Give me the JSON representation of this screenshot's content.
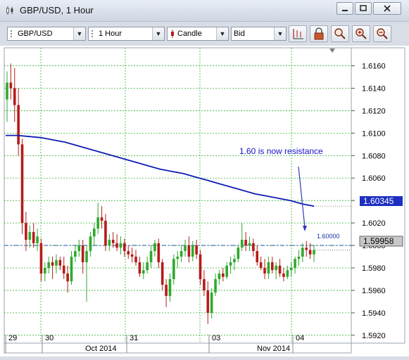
{
  "window": {
    "title": "GBP/USD,  1 Hour"
  },
  "toolbar": {
    "symbol": "GBP/USD",
    "timeframe": "1 Hour",
    "chart_type": "Candle",
    "price_side": "Bid",
    "buttons": [
      "grid-icon",
      "lock-icon",
      "zoom-icon",
      "zoom-in-icon",
      "zoom-out-icon"
    ]
  },
  "chart_data": {
    "type": "candlestick",
    "y_ticks": [
      "1.6160",
      "1.6140",
      "1.6120",
      "1.6100",
      "1.6080",
      "1.6060",
      "1.6040",
      "1.6020",
      "1.6000",
      "1.5980",
      "1.5960",
      "1.5940",
      "1.5920"
    ],
    "ylim": [
      1.5913,
      1.6176
    ],
    "x_day_labels": [
      "29",
      "30",
      "31",
      "03",
      "04"
    ],
    "x_month_labels": [
      "Oct 2014",
      "Nov 2014"
    ],
    "annotation": "1.60 is now resistance",
    "line_label": "1.60000",
    "price_badges": {
      "ma": "1.60345",
      "current": "1.59958"
    },
    "colors": {
      "up": "#2ea92e",
      "down": "#b51b1b",
      "ma": "#0d1cb5",
      "grid": "#35b535",
      "level": "#1133aa"
    },
    "candles": [
      [
        1.613,
        1.6155,
        1.611,
        1.6145
      ],
      [
        1.6145,
        1.6162,
        1.613,
        1.614
      ],
      [
        1.614,
        1.6158,
        1.611,
        1.6125
      ],
      [
        1.6125,
        1.614,
        1.608,
        1.609
      ],
      [
        1.609,
        1.6095,
        1.601,
        1.602
      ],
      [
        1.602,
        1.603,
        1.5995,
        1.6005
      ],
      [
        1.6005,
        1.6018,
        1.5998,
        1.6012
      ],
      [
        1.6012,
        1.602,
        1.5998,
        1.6002
      ],
      [
        1.6002,
        1.6015,
        1.5995,
        1.6008
      ],
      [
        1.6002,
        1.6006,
        1.5968,
        1.5975
      ],
      [
        1.5975,
        1.5985,
        1.5968,
        1.598
      ],
      [
        1.598,
        1.599,
        1.5975,
        1.5985
      ],
      [
        1.5985,
        1.599,
        1.597,
        1.5982
      ],
      [
        1.5982,
        1.5992,
        1.5975,
        1.5987
      ],
      [
        1.5987,
        1.599,
        1.5978,
        1.5982
      ],
      [
        1.5982,
        1.599,
        1.597,
        1.5975
      ],
      [
        1.5975,
        1.5982,
        1.5958,
        1.5968
      ],
      [
        1.5968,
        1.5995,
        1.5965,
        1.599
      ],
      [
        1.599,
        1.6,
        1.5985,
        1.5995
      ],
      [
        1.5995,
        1.6005,
        1.599,
        1.6
      ],
      [
        1.6,
        1.6005,
        1.5975,
        1.5985
      ],
      [
        1.5985,
        1.6,
        1.595,
        1.5995
      ],
      [
        1.5995,
        1.6012,
        1.599,
        1.6008
      ],
      [
        1.6008,
        1.602,
        1.6,
        1.6015
      ],
      [
        1.6015,
        1.6038,
        1.601,
        1.6025
      ],
      [
        1.6025,
        1.6035,
        1.6015,
        1.6022
      ],
      [
        1.6022,
        1.6028,
        1.5995,
        1.6
      ],
      [
        1.6,
        1.601,
        1.5995,
        1.6005
      ],
      [
        1.6005,
        1.6012,
        1.5998,
        1.6002
      ],
      [
        1.6002,
        1.601,
        1.5995,
        1.5998
      ],
      [
        1.5998,
        1.6008,
        1.5992,
        1.6002
      ],
      [
        1.6002,
        1.6006,
        1.599,
        1.5995
      ],
      [
        1.5995,
        1.6,
        1.5988,
        1.5992
      ],
      [
        1.5992,
        1.5998,
        1.5985,
        1.599
      ],
      [
        1.599,
        1.5996,
        1.5982,
        1.5985
      ],
      [
        1.5985,
        1.599,
        1.5972,
        1.5975
      ],
      [
        1.5975,
        1.5985,
        1.597,
        1.5978
      ],
      [
        1.5978,
        1.599,
        1.5975,
        1.5985
      ],
      [
        1.5985,
        1.6,
        1.598,
        1.5995
      ],
      [
        1.5995,
        1.6005,
        1.599,
        1.6002
      ],
      [
        1.6002,
        1.6006,
        1.598,
        1.5985
      ],
      [
        1.5985,
        1.5988,
        1.596,
        1.5965
      ],
      [
        1.5965,
        1.597,
        1.5945,
        1.5955
      ],
      [
        1.5955,
        1.5975,
        1.595,
        1.597
      ],
      [
        1.597,
        1.5992,
        1.5965,
        1.5988
      ],
      [
        1.5988,
        1.5995,
        1.598,
        1.599
      ],
      [
        1.599,
        1.6,
        1.5985,
        1.5995
      ],
      [
        1.5995,
        1.6005,
        1.599,
        1.6
      ],
      [
        1.6,
        1.6008,
        1.5985,
        1.599
      ],
      [
        1.599,
        1.6004,
        1.5986,
        1.6
      ],
      [
        1.6,
        1.6005,
        1.5988,
        1.5992
      ],
      [
        1.5992,
        1.5996,
        1.5965,
        1.597
      ],
      [
        1.597,
        1.5978,
        1.5955,
        1.596
      ],
      [
        1.596,
        1.5968,
        1.593,
        1.594
      ],
      [
        1.594,
        1.5962,
        1.5935,
        1.5958
      ],
      [
        1.5958,
        1.5975,
        1.5955,
        1.597
      ],
      [
        1.597,
        1.5978,
        1.5965,
        1.5975
      ],
      [
        1.5975,
        1.598,
        1.5968,
        1.5972
      ],
      [
        1.5972,
        1.5985,
        1.597,
        1.5982
      ],
      [
        1.5982,
        1.599,
        1.5975,
        1.5985
      ],
      [
        1.5985,
        1.5992,
        1.5978,
        1.5988
      ],
      [
        1.5988,
        1.6,
        1.5985,
        1.5998
      ],
      [
        1.5998,
        1.602,
        1.5995,
        1.6005
      ],
      [
        1.6005,
        1.6012,
        1.5995,
        1.6
      ],
      [
        1.6,
        1.6008,
        1.5995,
        1.6002
      ],
      [
        1.6002,
        1.6006,
        1.599,
        1.5995
      ],
      [
        1.5995,
        1.6,
        1.5982,
        1.5985
      ],
      [
        1.5985,
        1.599,
        1.5978,
        1.598
      ],
      [
        1.598,
        1.5988,
        1.597,
        1.5975
      ],
      [
        1.5975,
        1.599,
        1.597,
        1.5985
      ],
      [
        1.5985,
        1.599,
        1.5975,
        1.5978
      ],
      [
        1.5978,
        1.5985,
        1.597,
        1.5982
      ],
      [
        1.5982,
        1.5988,
        1.5972,
        1.5975
      ],
      [
        1.5975,
        1.598,
        1.5968,
        1.5972
      ],
      [
        1.5972,
        1.5982,
        1.597,
        1.5978
      ],
      [
        1.5978,
        1.5985,
        1.5972,
        1.598
      ],
      [
        1.598,
        1.599,
        1.5975,
        1.5988
      ],
      [
        1.5988,
        1.5996,
        1.5982,
        1.599
      ],
      [
        1.599,
        1.6002,
        1.5985,
        1.5998
      ],
      [
        1.5998,
        1.6004,
        1.599,
        1.5996
      ],
      [
        1.5996,
        1.6002,
        1.5988,
        1.5992
      ],
      [
        1.5992,
        1.6,
        1.5985,
        1.5996
      ]
    ],
    "ma": [
      1.6098,
      1.6098,
      1.6097,
      1.6096,
      1.6094,
      1.6092,
      1.6089,
      1.6086,
      1.6083,
      1.608,
      1.6077,
      1.6074,
      1.6071,
      1.6068,
      1.6066,
      1.6064,
      1.6061,
      1.6058,
      1.6055,
      1.6052,
      1.6049,
      1.6046,
      1.6044,
      1.6042,
      1.604,
      1.6037,
      1.6035
    ]
  }
}
